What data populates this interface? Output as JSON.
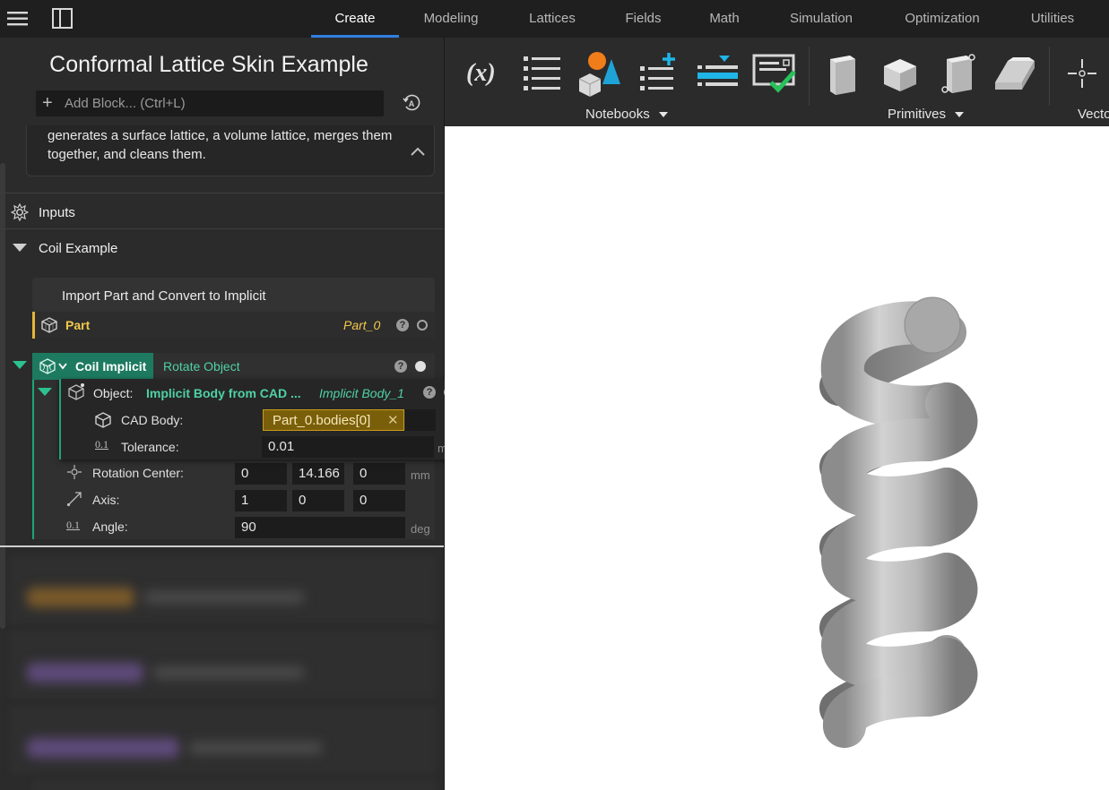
{
  "topbar": {
    "tabs": [
      "Create",
      "Modeling",
      "Lattices",
      "Fields",
      "Math",
      "Simulation",
      "Optimization",
      "Utilities"
    ],
    "active_tab": "Create"
  },
  "notebook": {
    "title": "Conformal Lattice Skin Example",
    "add_block_placeholder": "Add Block... (Ctrl+L)",
    "description": "generates a surface lattice, a volume lattice, merges them together, and cleans them."
  },
  "sections": {
    "inputs_label": "Inputs",
    "group_label": "Coil Example"
  },
  "import_block": {
    "title": "Import Part and Convert to Implicit",
    "part_label": "Part",
    "part_value": "Part_0",
    "help": "?"
  },
  "coil_block": {
    "name": "Coil Implicit",
    "operation": "Rotate Object",
    "help": "?",
    "object": {
      "label": "Object:",
      "value": "Implicit Body from CAD ...",
      "ref": "Implicit Body_1",
      "help": "?",
      "cad_body_label": "CAD Body:",
      "cad_body_value": "Part_0.bodies[0]",
      "cad_body_clear": "✕",
      "tolerance_label": "Tolerance:",
      "tolerance_value": "0.01",
      "tolerance_unit": "mm",
      "tolerance_icon_text": "0.1"
    },
    "rotation_center_label": "Rotation Center:",
    "rotation_center": [
      "0",
      "14.166",
      "0"
    ],
    "rotation_center_unit": "mm",
    "axis_label": "Axis:",
    "axis": [
      "1",
      "0",
      "0"
    ],
    "angle_label": "Angle:",
    "angle_value": "90",
    "angle_unit": "deg",
    "angle_icon_text": "0.1"
  },
  "ribbon": {
    "groups": [
      "Notebooks",
      "Primitives",
      "Vecto"
    ],
    "formula_label": "(x)"
  },
  "colors": {
    "accent_blue": "#2f7fe0",
    "part_yellow": "#f2c94c",
    "implicit_green": "#1d7a60",
    "implicit_text": "#4fd1a5",
    "cad_chip": "#7a5f0a"
  }
}
